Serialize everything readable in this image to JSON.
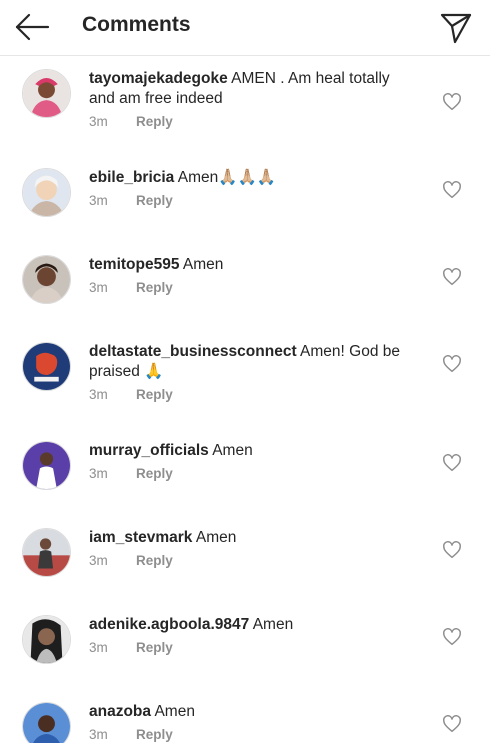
{
  "header": {
    "title": "Comments",
    "back_icon": "arrow-left-icon",
    "send_icon": "paper-plane-icon"
  },
  "comments": [
    {
      "username": "tayomajekadegoke",
      "text": " AMEN . Am heal totally and am free indeed",
      "time": "3m",
      "reply": "Reply"
    },
    {
      "username": "ebile_bricia",
      "text": " Amen🙏🏼🙏🏼🙏🏼",
      "time": "3m",
      "reply": "Reply"
    },
    {
      "username": "temitope595",
      "text": " Amen",
      "time": "3m",
      "reply": "Reply"
    },
    {
      "username": "deltastate_businessconnect",
      "text": " Amen!  God be praised 🙏",
      "time": "3m",
      "reply": "Reply"
    },
    {
      "username": "murray_officials",
      "text": " Amen",
      "time": "3m",
      "reply": "Reply"
    },
    {
      "username": "iam_stevmark",
      "text": " Amen",
      "time": "3m",
      "reply": "Reply"
    },
    {
      "username": "adenike.agboola.9847",
      "text": " Amen",
      "time": "3m",
      "reply": "Reply"
    },
    {
      "username": "anazoba",
      "text": " Amen",
      "time": "3m",
      "reply": "Reply"
    }
  ],
  "colors": {
    "text": "#262626",
    "secondary": "#8e8e8e",
    "divider": "#e6e6e6"
  }
}
